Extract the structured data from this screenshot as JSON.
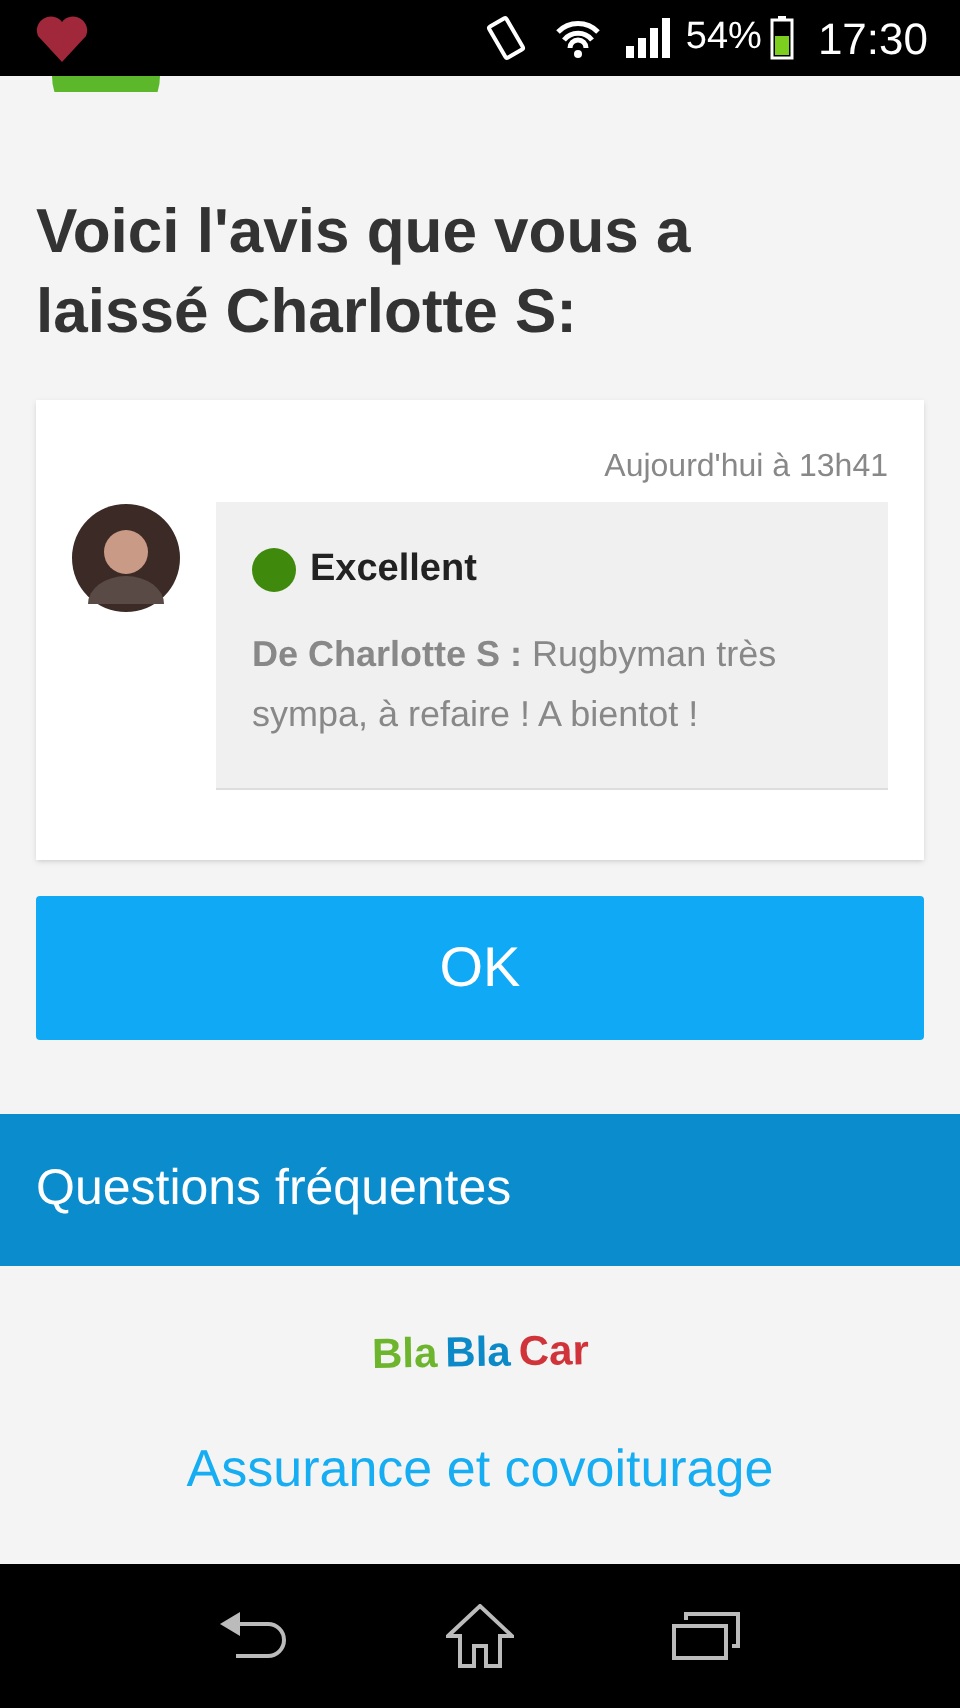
{
  "status_bar": {
    "battery": "54%",
    "time": "17:30"
  },
  "title": "Voici l'avis que vous a laissé Charlotte S:",
  "review": {
    "timestamp": "Aujourd'hui à 13h41",
    "rating": {
      "label": "Excellent",
      "color": "#3f8a0c"
    },
    "text": "**De Charlotte S :** Rugbyman très sympa, à refaire ! A bientot !"
  },
  "ok_button": "OK",
  "faq": {
    "title": "Questions fréquentes"
  },
  "logo": [
    {
      "text": "Bla",
      "color": "#6cb52d"
    },
    {
      "text": "Bla",
      "color": "#0c8ac7"
    },
    {
      "text": "Car",
      "color": "#d0343a"
    }
  ],
  "link": "Assurance et covoiturage"
}
